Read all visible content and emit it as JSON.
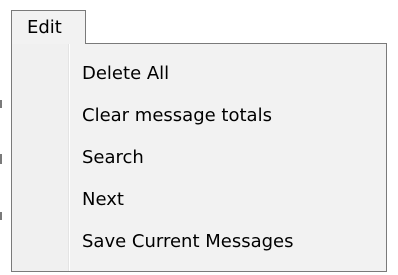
{
  "menubar": {
    "edit_label": "Edit"
  },
  "edit_menu": {
    "items": [
      {
        "label": "Delete All"
      },
      {
        "label": "Clear message totals"
      },
      {
        "label": "Search"
      },
      {
        "label": "Next"
      },
      {
        "label": "Save Current Messages"
      }
    ]
  }
}
